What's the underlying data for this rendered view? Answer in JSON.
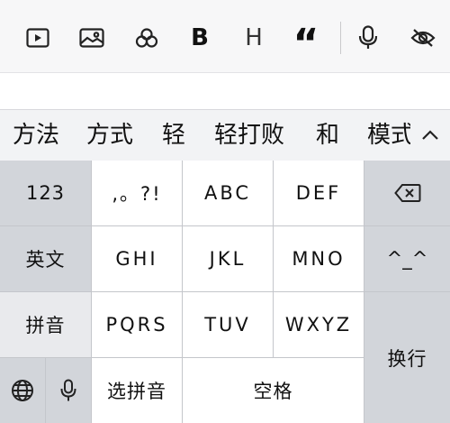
{
  "toolbar": {
    "bold_label": "B",
    "heading_label": "H",
    "quote_label": "“"
  },
  "candidates": [
    "方法",
    "方式",
    "轻",
    "轻打败",
    "和",
    "模式"
  ],
  "keyboard": {
    "num_label": "123",
    "english_label": "英文",
    "pinyin_label": "拼音",
    "punct_label": ",。?!",
    "abc_label": "ABC",
    "def_label": "DEF",
    "ghi_label": "GHI",
    "jkl_label": "JKL",
    "mno_label": "MNO",
    "pqrs_label": "PQRS",
    "tuv_label": "TUV",
    "wxyz_label": "WXYZ",
    "emoji_label": "^_^",
    "select_pinyin_label": "选拼音",
    "space_label": "空格",
    "return_label": "换行"
  },
  "icons": {
    "video": "video-icon",
    "image": "image-icon",
    "circles": "circles-icon",
    "mic": "microphone-icon",
    "eye_off": "eye-off-icon",
    "chevron_up": "chevron-up-icon",
    "delete": "delete-icon",
    "globe": "globe-icon"
  }
}
